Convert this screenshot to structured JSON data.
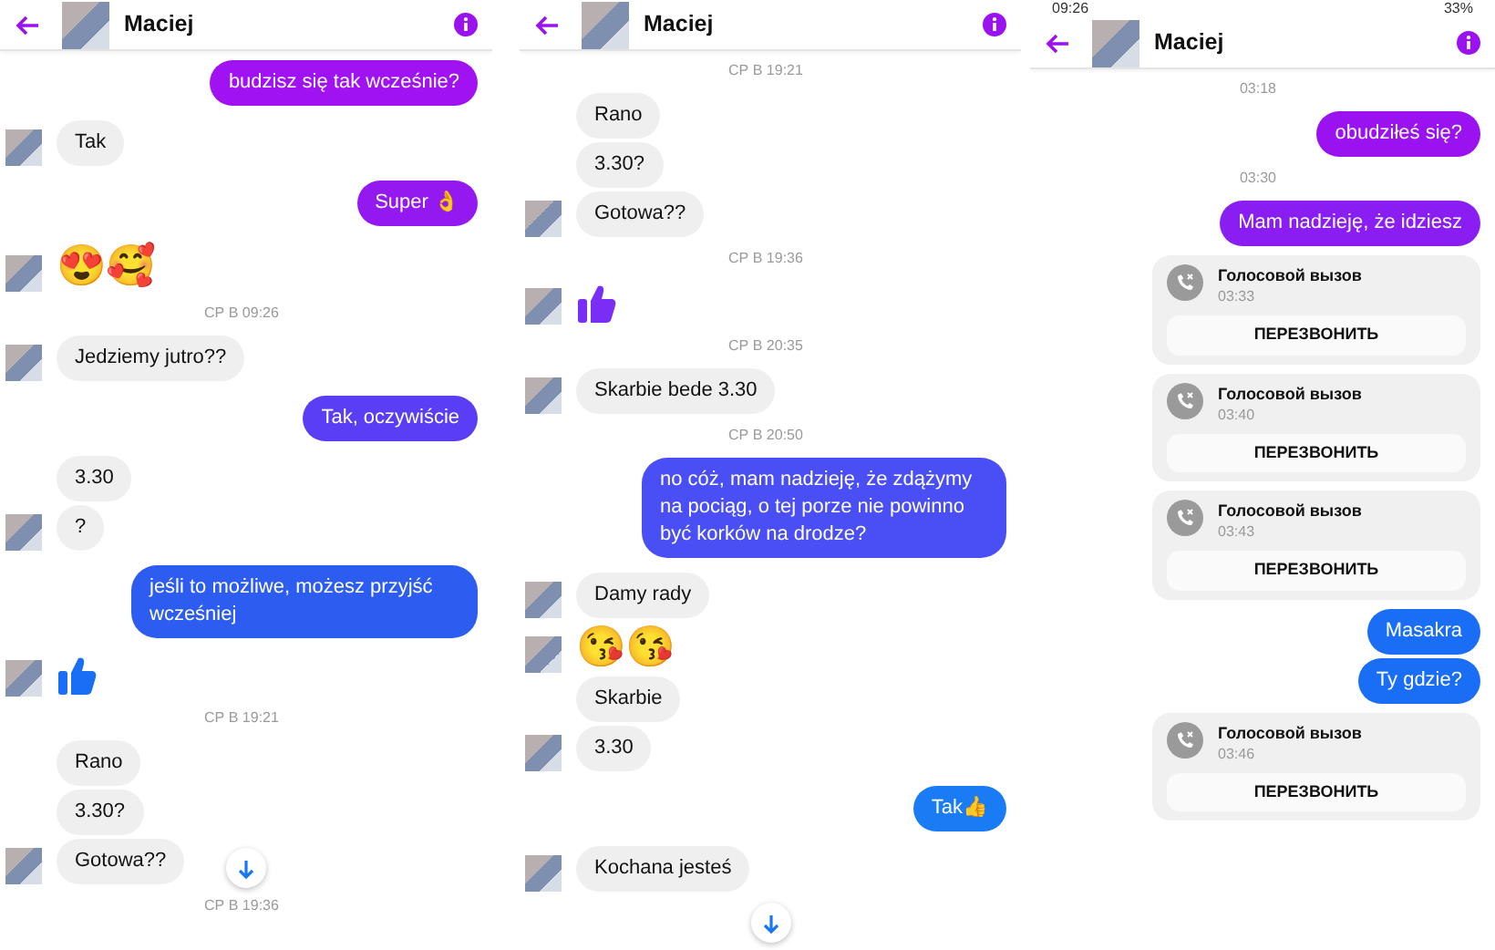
{
  "panels": [
    {
      "header": {
        "title": "Maciej"
      },
      "scroll_down_button": true,
      "messages": [
        {
          "kind": "text",
          "outgoing": true,
          "text": "budzisz się tak wcześnie?",
          "color": "#a012f2"
        },
        {
          "kind": "text",
          "outgoing": false,
          "text": "Tak",
          "avatar": true
        },
        {
          "kind": "text",
          "outgoing": true,
          "text": "Super 👌",
          "color": "#9418f0"
        },
        {
          "kind": "emoji",
          "outgoing": false,
          "text": "😍🥰",
          "avatar": true
        },
        {
          "kind": "timestamp",
          "text": "СР В 09:26"
        },
        {
          "kind": "text",
          "outgoing": false,
          "text": "Jedziemy jutro??",
          "avatar": true
        },
        {
          "kind": "text",
          "outgoing": true,
          "text": "Tak, oczywiście",
          "color": "#5a3ef5"
        },
        {
          "kind": "text",
          "outgoing": false,
          "text": "3.30",
          "avatar": false
        },
        {
          "kind": "text",
          "outgoing": false,
          "text": "?",
          "avatar": true
        },
        {
          "kind": "text",
          "outgoing": true,
          "text": "jeśli to możliwe, możesz przyjść wcześniej",
          "color": "#2d5cf0"
        },
        {
          "kind": "like",
          "outgoing": false,
          "color": "#1a6ef5",
          "avatar": true
        },
        {
          "kind": "timestamp",
          "text": "СР В 19:21"
        },
        {
          "kind": "text",
          "outgoing": false,
          "text": "Rano",
          "avatar": false
        },
        {
          "kind": "text",
          "outgoing": false,
          "text": "3.30?",
          "avatar": false
        },
        {
          "kind": "text",
          "outgoing": false,
          "text": "Gotowa??",
          "avatar": true
        },
        {
          "kind": "timestamp",
          "text": "СР В 19:36"
        }
      ]
    },
    {
      "header": {
        "title": "Maciej"
      },
      "scroll_down_button": true,
      "messages": [
        {
          "kind": "timestamp",
          "text": "СР В 19:21"
        },
        {
          "kind": "text",
          "outgoing": false,
          "text": "Rano",
          "avatar": false
        },
        {
          "kind": "text",
          "outgoing": false,
          "text": "3.30?",
          "avatar": false
        },
        {
          "kind": "text",
          "outgoing": false,
          "text": "Gotowa??",
          "avatar": true
        },
        {
          "kind": "timestamp",
          "text": "СР В 19:36"
        },
        {
          "kind": "like",
          "outgoing": false,
          "color": "#7a2ef5",
          "avatar": true
        },
        {
          "kind": "timestamp",
          "text": "СР В 20:35"
        },
        {
          "kind": "text",
          "outgoing": false,
          "text": "Skarbie bede 3.30",
          "avatar": true
        },
        {
          "kind": "timestamp",
          "text": "СР В 20:50"
        },
        {
          "kind": "text",
          "outgoing": true,
          "text": "no cóż, mam nadzieję, że zdążymy na pociąg, o tej porze nie powinno być korków na drodze?",
          "color": "#4a4ef5"
        },
        {
          "kind": "text",
          "outgoing": false,
          "text": "Damy rady",
          "avatar": true
        },
        {
          "kind": "emoji",
          "outgoing": false,
          "text": "😘😘",
          "avatar": true
        },
        {
          "kind": "text",
          "outgoing": false,
          "text": "Skarbie",
          "avatar": false
        },
        {
          "kind": "text",
          "outgoing": false,
          "text": "3.30",
          "avatar": true
        },
        {
          "kind": "text",
          "outgoing": true,
          "text": "Tak👍",
          "color": "#1a7cf5"
        },
        {
          "kind": "text",
          "outgoing": false,
          "text": "Kochana jesteś",
          "avatar": true
        }
      ]
    },
    {
      "status_bar": {
        "time": "09:26",
        "battery": "33%"
      },
      "header": {
        "title": "Maciej"
      },
      "scroll_down_button": false,
      "messages": [
        {
          "kind": "timestamp",
          "text": "03:18"
        },
        {
          "kind": "text",
          "outgoing": true,
          "text": "obudziłeś się?",
          "color": "#9b12f0"
        },
        {
          "kind": "timestamp",
          "text": "03:30"
        },
        {
          "kind": "text",
          "outgoing": true,
          "text": "Mam nadzieję, że idziesz",
          "color": "#8a1ef2"
        },
        {
          "kind": "call",
          "title": "Голосовой вызов",
          "time": "03:33",
          "button": "ПЕРЕЗВОНИТЬ"
        },
        {
          "kind": "call",
          "title": "Голосовой вызов",
          "time": "03:40",
          "button": "ПЕРЕЗВОНИТЬ"
        },
        {
          "kind": "call",
          "title": "Голосовой вызов",
          "time": "03:43",
          "button": "ПЕРЕЗВОНИТЬ"
        },
        {
          "kind": "text",
          "outgoing": true,
          "text": "Masakra",
          "color": "#1a6ef5"
        },
        {
          "kind": "text",
          "outgoing": true,
          "text": "Ty gdzie?",
          "color": "#1a6ef5"
        },
        {
          "kind": "call",
          "title": "Голосовой вызов",
          "time": "03:46",
          "button": "ПЕРЕЗВОНИТЬ"
        }
      ]
    }
  ]
}
